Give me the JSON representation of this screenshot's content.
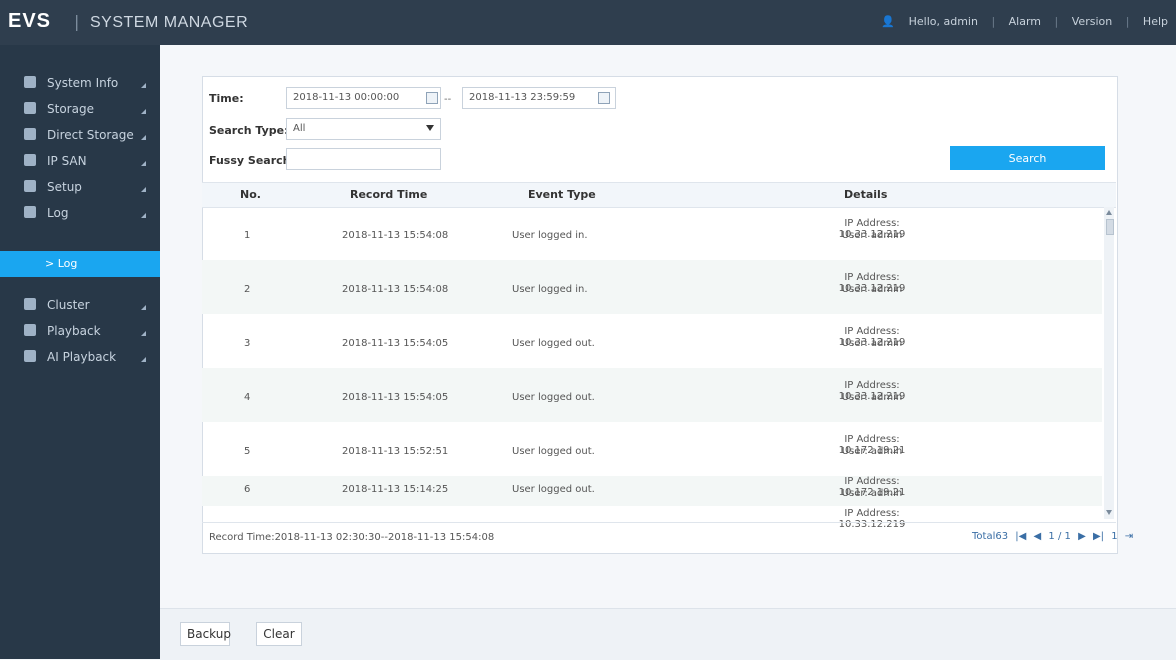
{
  "header": {
    "logo": "EVS",
    "title": "SYSTEM MANAGER",
    "user": "Hello, admin",
    "alarm": "Alarm",
    "version": "Version",
    "help": "Help"
  },
  "sidebar": {
    "items": [
      {
        "label": "System Info",
        "icon": "info-icon"
      },
      {
        "label": "Storage",
        "icon": "storage-icon"
      },
      {
        "label": "Direct Storage",
        "icon": "direct-storage-icon"
      },
      {
        "label": "IP SAN",
        "icon": "ip-san-icon"
      },
      {
        "label": "Setup",
        "icon": "gear-icon"
      },
      {
        "label": "Log",
        "icon": "log-icon"
      },
      {
        "label": "Cluster",
        "icon": "cluster-icon"
      },
      {
        "label": "Playback",
        "icon": "playback-icon"
      },
      {
        "label": "AI Playback",
        "icon": "ai-playback-icon"
      }
    ],
    "active_sub": "> Log"
  },
  "filters": {
    "time_label": "Time:",
    "start_time": "2018-11-13 00:00:00",
    "end_time": "2018-11-13 23:59:59",
    "dash": "--",
    "search_type_label": "Search Type:",
    "search_type_value": "All",
    "fuzzy_label": "Fussy Search:",
    "fuzzy_value": "",
    "search_button": "Search"
  },
  "table": {
    "columns": [
      "No.",
      "Record Time",
      "Event Type",
      "Details"
    ],
    "rows": [
      {
        "no": "1",
        "time": "2018-11-13 15:54:08",
        "event": "User logged in.",
        "ip": "IP Address: 10.33.12.219",
        "user": "User: admin"
      },
      {
        "no": "2",
        "time": "2018-11-13 15:54:08",
        "event": "User logged in.",
        "ip": "IP Address: 10.33.12.219",
        "user": "User: admin"
      },
      {
        "no": "3",
        "time": "2018-11-13 15:54:05",
        "event": "User logged out.",
        "ip": "IP Address: 10.33.12.219",
        "user": "User: admin"
      },
      {
        "no": "4",
        "time": "2018-11-13 15:54:05",
        "event": "User logged out.",
        "ip": "IP Address: 10.33.12.219",
        "user": "User: admin"
      },
      {
        "no": "5",
        "time": "2018-11-13 15:52:51",
        "event": "User logged out.",
        "ip": "IP Address: 10.172.19.21",
        "user": "User: admin"
      },
      {
        "no": "6",
        "time": "2018-11-13 15:14:25",
        "event": "User logged out.",
        "ip": "IP Address: 10.172.19.21",
        "user": "User: admin"
      },
      {
        "no": "",
        "time": "",
        "event": "",
        "ip": "IP Address: 10.33.12.219",
        "user": ""
      }
    ]
  },
  "footer": {
    "record_time": "Record Time:2018-11-13 02:30:30--2018-11-13 15:54:08",
    "total": "Total63",
    "page": "1 / 1",
    "page_input": "1"
  },
  "actions": {
    "backup": "Backup",
    "clear": "Clear"
  }
}
